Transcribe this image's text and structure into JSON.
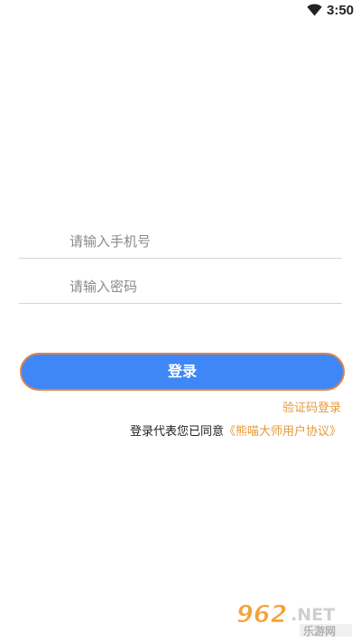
{
  "status_bar": {
    "time": "3:50",
    "wifi_icon": "wifi-icon"
  },
  "form": {
    "phone_placeholder": "请输入手机号",
    "password_placeholder": "请输入密码",
    "login_label": "登录",
    "sms_login_label": "验证码登录",
    "agreement_prefix": "登录代表您已同意",
    "agreement_link": "《熊喵大师用户协议》"
  },
  "watermark": {
    "logo_text": "962.NET",
    "logo_subtext": "乐游网"
  },
  "colors": {
    "primary_button": "#3f87f6",
    "button_border": "#e0834a",
    "link": "#e59a3c",
    "divider": "#d5d5d5"
  }
}
